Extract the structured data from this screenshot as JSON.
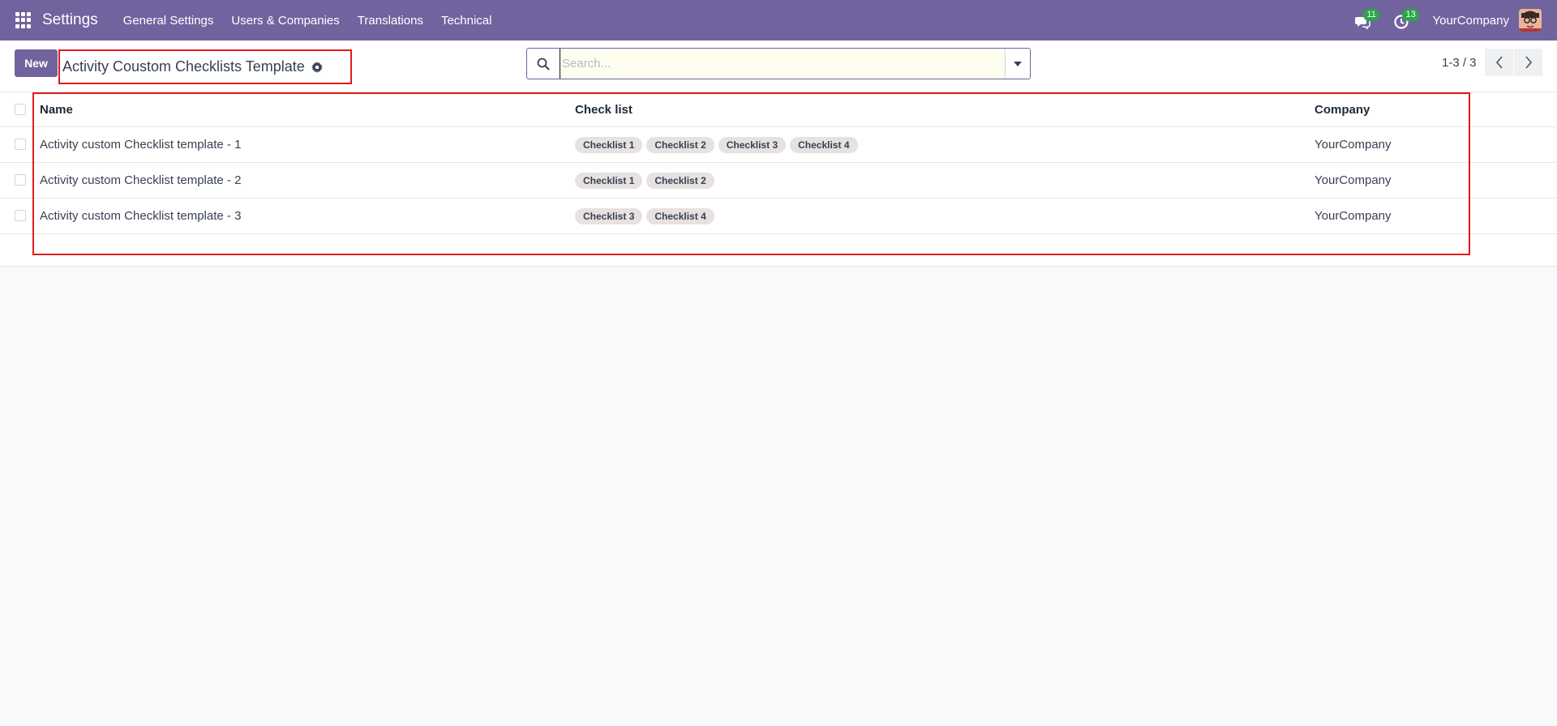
{
  "navbar": {
    "app_name": "Settings",
    "menu": [
      "General Settings",
      "Users & Companies",
      "Translations",
      "Technical"
    ],
    "messages_badge": "11",
    "activities_badge": "13",
    "company": "YourCompany"
  },
  "control": {
    "new_label": "New",
    "title": "Activity Coustom Checklists Template",
    "search_placeholder": "Search...",
    "pager": "1-3 / 3"
  },
  "list": {
    "columns": [
      "Name",
      "Check list",
      "Company"
    ],
    "rows": [
      {
        "name": "Activity custom Checklist template - 1",
        "tags": [
          "Checklist 1",
          "Checklist 2",
          "Checklist 3",
          "Checklist 4"
        ],
        "company": "YourCompany"
      },
      {
        "name": "Activity custom Checklist template - 2",
        "tags": [
          "Checklist 1",
          "Checklist 2"
        ],
        "company": "YourCompany"
      },
      {
        "name": "Activity custom Checklist template - 3",
        "tags": [
          "Checklist 3",
          "Checklist 4"
        ],
        "company": "YourCompany"
      }
    ]
  },
  "colors": {
    "brand": "#71639e",
    "highlight": "#e21b1b",
    "badge": "#28a745"
  },
  "icons": [
    "apps-grid-icon",
    "chat-icon",
    "clock-icon",
    "gear-icon",
    "search-icon",
    "caret-down-icon",
    "chevron-left-icon",
    "chevron-right-icon"
  ]
}
